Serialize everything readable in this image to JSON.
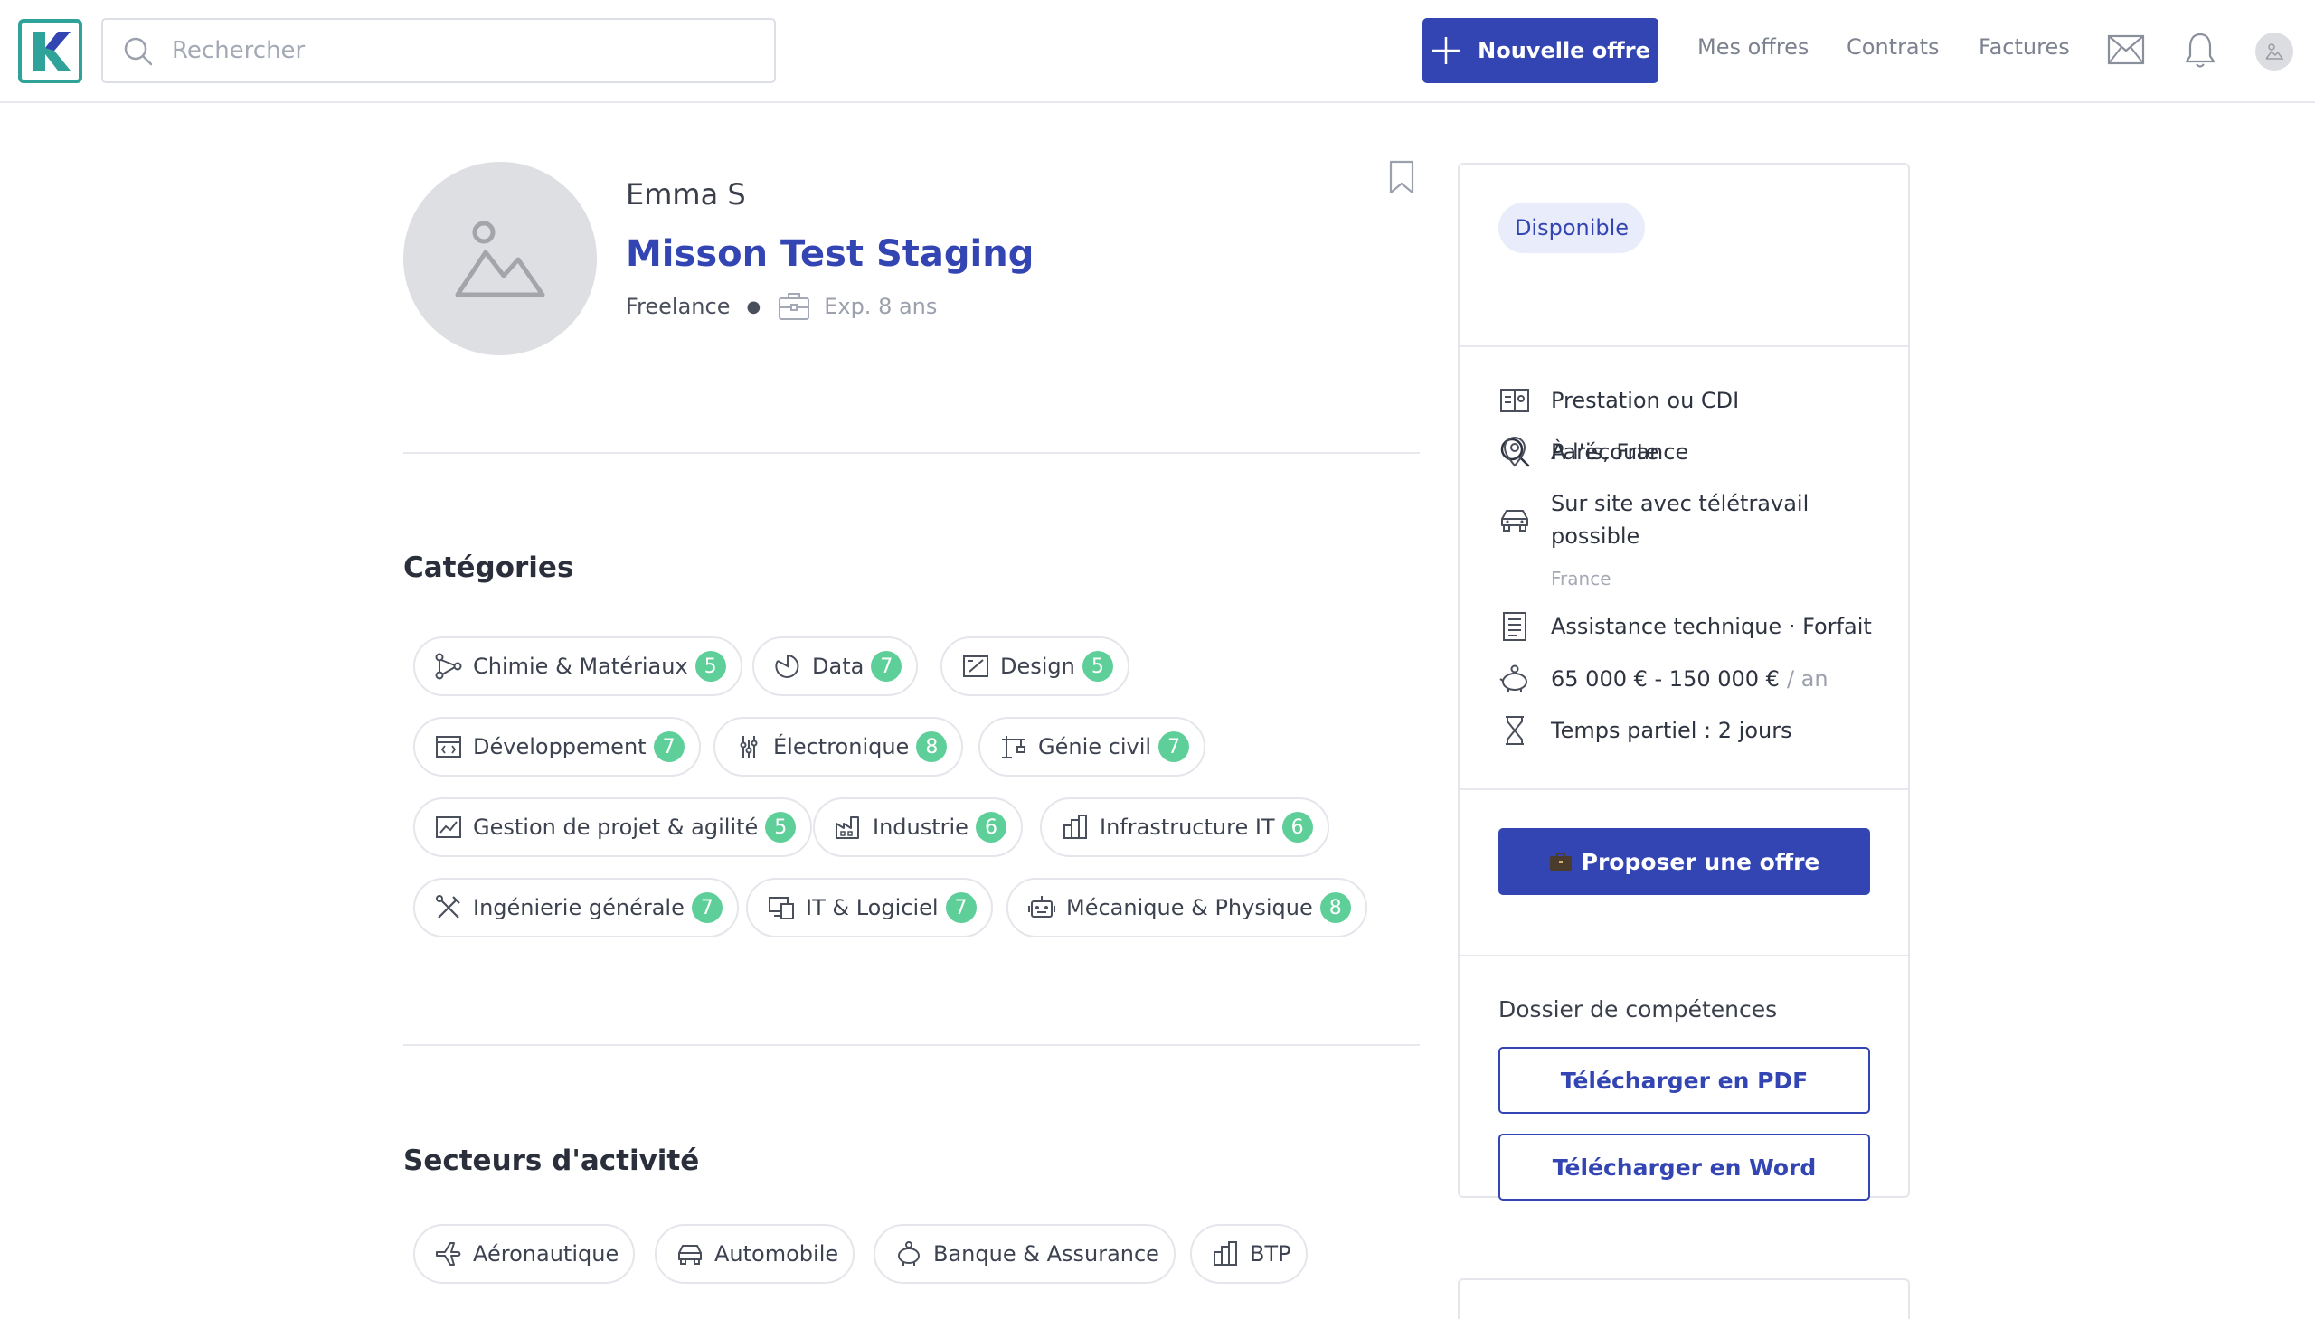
{
  "header": {
    "logo_letter": "K",
    "search_placeholder": "Rechercher",
    "new_offer_label": "Nouvelle offre",
    "nav": [
      "Mes offres",
      "Contrats",
      "Factures"
    ],
    "icons": [
      "search-icon",
      "plus-icon",
      "mail-icon",
      "bell-icon",
      "avatar"
    ]
  },
  "profile": {
    "name": "Emma S",
    "title": "Misson Test Staging",
    "type": "Freelance",
    "experience": "Exp. 8 ans"
  },
  "categories": {
    "title": "Catégories",
    "items": [
      {
        "label": "Chimie & Matériaux",
        "count": "5",
        "icon": "molecule-icon"
      },
      {
        "label": "Data",
        "count": "7",
        "icon": "pie-chart-icon"
      },
      {
        "label": "Design",
        "count": "5",
        "icon": "design-icon"
      },
      {
        "label": "Développement",
        "count": "7",
        "icon": "code-window-icon"
      },
      {
        "label": "Électronique",
        "count": "8",
        "icon": "circuit-icon"
      },
      {
        "label": "Génie civil",
        "count": "7",
        "icon": "crane-icon"
      },
      {
        "label": "Gestion de projet & agilité",
        "count": "5",
        "icon": "chart-board-icon"
      },
      {
        "label": "Industrie",
        "count": "6",
        "icon": "factory-icon"
      },
      {
        "label": "Infrastructure IT",
        "count": "6",
        "icon": "buildings-icon"
      },
      {
        "label": "Ingénierie générale",
        "count": "7",
        "icon": "tools-icon"
      },
      {
        "label": "IT & Logiciel",
        "count": "7",
        "icon": "devices-icon"
      },
      {
        "label": "Mécanique & Physique",
        "count": "8",
        "icon": "robot-icon"
      }
    ]
  },
  "sectors": {
    "title": "Secteurs d'activité",
    "items": [
      {
        "label": "Aéronautique",
        "icon": "plane-icon"
      },
      {
        "label": "Automobile",
        "icon": "car-icon"
      },
      {
        "label": "Banque & Assurance",
        "icon": "piggy-bank-icon"
      },
      {
        "label": "BTP",
        "icon": "buildings-icon"
      }
    ]
  },
  "sidebar": {
    "status": "Disponible",
    "listening": "À l'écoute",
    "contract": "Prestation ou CDI",
    "location": "Paris, France",
    "remote_line1": "Sur site avec télétravail",
    "remote_line2": "possible",
    "remote_note": "France",
    "mission_type": "Assistance technique · Forfait",
    "salary": "65 000 € - 150 000 €",
    "salary_unit": "/ an",
    "schedule": "Temps partiel : 2 jours",
    "propose_label": "Proposer une offre",
    "dossier_label": "Dossier de compétences",
    "pdf_label": "Télécharger en PDF",
    "word_label": "Télécharger en Word"
  },
  "colors": {
    "primary": "#3345b3",
    "badge": "#5fcf9a",
    "logo": "#2fa39a",
    "status_bg": "#e9ecfa"
  }
}
